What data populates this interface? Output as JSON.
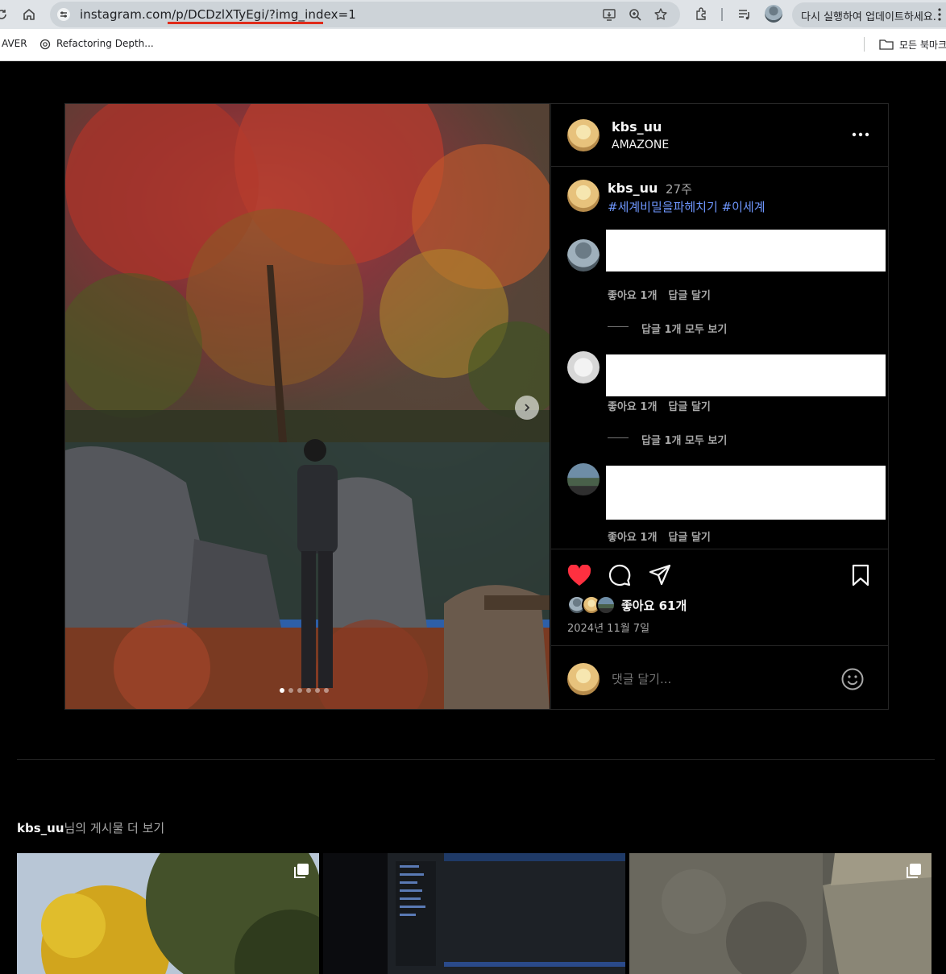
{
  "browser": {
    "url": "instagram.com/p/DCDzlXTyEgi/?img_index=1",
    "update_label": "다시 실행하여 업데이트하세요.",
    "bookmarks": {
      "left_cut": "AVER",
      "item1": "Refactoring Depth...",
      "all_bookmarks": "모든 북마크"
    },
    "underline_color": "#e02b1a"
  },
  "post": {
    "header": {
      "username": "kbs_uu",
      "subtitle": "AMAZONE"
    },
    "caption": {
      "username": "kbs_uu",
      "time": "27주",
      "hashtags": "#세계비밀을파헤치기 #이세계"
    },
    "comments": [
      {
        "avatar": "man-photo",
        "likes": "좋아요 1개",
        "reply": "답글 달기",
        "view_replies": "답글 1개 모두 보기"
      },
      {
        "avatar": "dog-photo",
        "likes": "좋아요 1개",
        "reply": "답글 달기",
        "view_replies": "답글 1개 모두 보기"
      },
      {
        "avatar": "car-photo",
        "likes": "좋아요 1개",
        "reply": "답글 달기"
      }
    ],
    "actions": {
      "like_color": "#ff3040"
    },
    "likes": "좋아요 61개",
    "date": "2024년 11월 7일",
    "comment_placeholder": "댓글 달기...",
    "carousel": {
      "current": 1,
      "total": 6
    }
  },
  "more": {
    "username": "kbs_uu",
    "suffix": "님의 게시물 더 보기"
  }
}
